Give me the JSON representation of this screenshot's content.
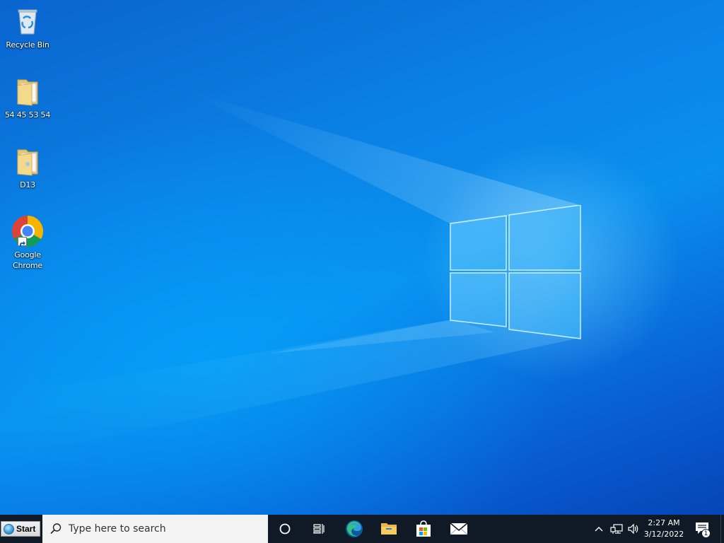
{
  "desktop": {
    "icons": [
      {
        "label": "Recycle Bin",
        "icon": "recycle-bin-icon"
      },
      {
        "label": "54 45 53 54",
        "icon": "folder-icon"
      },
      {
        "label": "D13",
        "icon": "folder-icon"
      },
      {
        "label": "Google\nChrome",
        "icon": "chrome-icon",
        "shortcut": true
      }
    ],
    "wallpaper_logo": "windows-logo"
  },
  "taskbar": {
    "start_label": "Start",
    "search_placeholder": "Type here to search",
    "pinned": [
      {
        "name": "cortana",
        "icon": "cortana-circle-icon"
      },
      {
        "name": "task-view",
        "icon": "task-view-icon"
      },
      {
        "name": "edge",
        "icon": "edge-icon"
      },
      {
        "name": "file-explorer",
        "icon": "folder-icon"
      },
      {
        "name": "microsoft-store",
        "icon": "store-bag-icon"
      },
      {
        "name": "mail",
        "icon": "mail-icon"
      }
    ],
    "tray": {
      "icons": [
        "chevron-up-icon",
        "network-icon",
        "volume-icon"
      ],
      "time": "2:27 AM",
      "date": "3/12/2022",
      "notification_count": "1"
    }
  },
  "colors": {
    "taskbar_bg": "#101a26",
    "search_bg": "#f3f3f3",
    "wallpaper_accent": "#0a82e6"
  }
}
